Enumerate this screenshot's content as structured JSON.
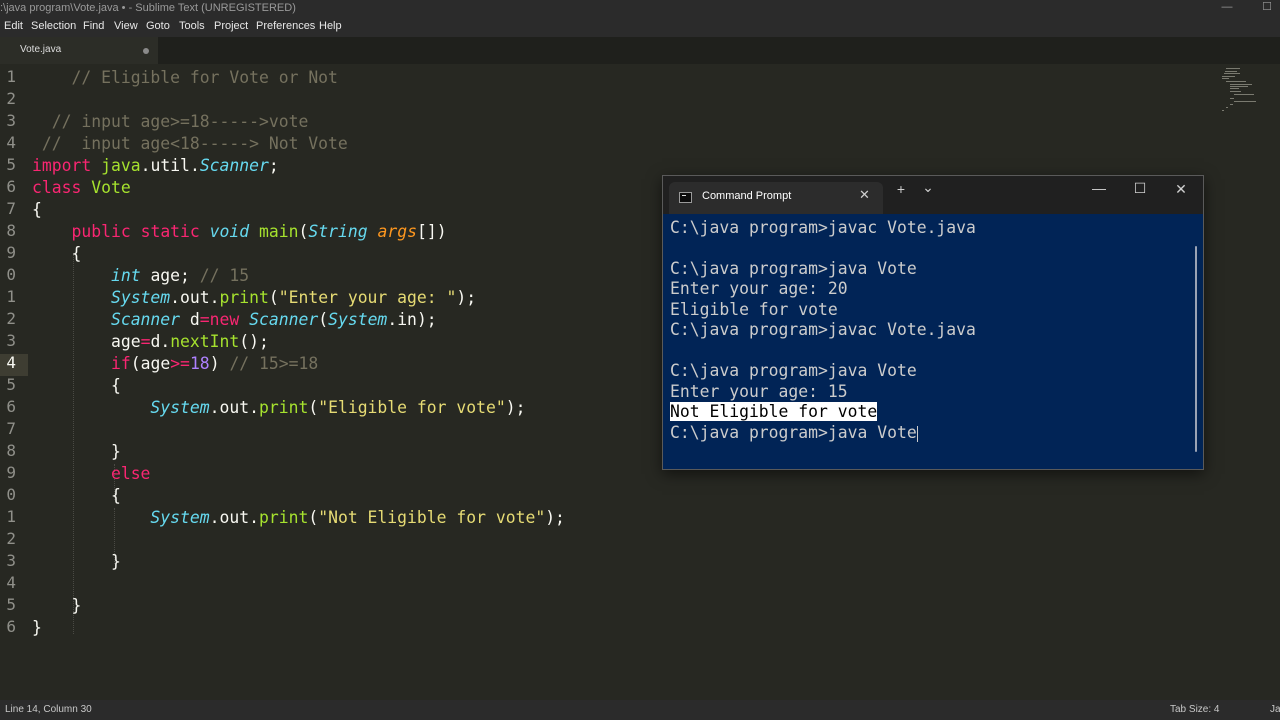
{
  "window": {
    "title": ":\\java program\\Vote.java • - Sublime Text (UNREGISTERED)",
    "minimize_glyph": "—",
    "maximize_glyph": "☐"
  },
  "menu": [
    "Edit",
    "Selection",
    "Find",
    "View",
    "Goto",
    "Tools",
    "Project",
    "Preferences",
    "Help"
  ],
  "tab": {
    "label": "Vote.java"
  },
  "gutter": [
    "1",
    "2",
    "3",
    "4",
    "5",
    "6",
    "7",
    "8",
    "9",
    "0",
    "1",
    "2",
    "3",
    "4",
    "5",
    "6",
    "7",
    "8",
    "9",
    "0",
    "1",
    "2",
    "3",
    "4",
    "5",
    "6"
  ],
  "code": [
    "    // Eligible for Vote or Not",
    "",
    "  // input age>=18----->vote",
    " //  input age<18-----> Not Vote",
    "import java.util.Scanner;",
    "class Vote",
    "{",
    "    public static void main(String args[])",
    "    {",
    "        int age; // 15",
    "        System.out.print(\"Enter your age: \");",
    "        Scanner d=new Scanner(System.in);",
    "        age=d.nextInt();",
    "        if(age>=18) // 15>=18",
    "        {",
    "            System.out.print(\"Eligible for vote\");",
    "",
    "        }",
    "        else",
    "        {",
    "            System.out.print(\"Not Eligible for vote\");",
    "",
    "        }",
    "",
    "    }",
    "}"
  ],
  "status": {
    "position": "Line 14, Column 30",
    "tab_size": "Tab Size: 4",
    "syntax": "Ja"
  },
  "cmd": {
    "tab_title": "Command Prompt",
    "close_glyph": "✕",
    "new_tab_glyph": "+",
    "dropdown_glyph": "⌄",
    "min_glyph": "—",
    "max_glyph": "☐",
    "win_close_glyph": "✕",
    "lines": [
      "C:\\java program>javac Vote.java",
      "",
      "C:\\java program>java Vote",
      "Enter your age: 20",
      "Eligible for vote",
      "C:\\java program>javac Vote.java",
      "",
      "C:\\java program>java Vote",
      "Enter your age: 15",
      "Not Eligible for vote",
      "C:\\java program>java Vote"
    ]
  },
  "colors": {
    "editor_bg": "#272822",
    "cmd_bg": "#012456",
    "keyword": "#f92672",
    "type": "#66d9ef",
    "function": "#a6e22e",
    "string": "#e6db74",
    "number": "#ae81ff",
    "comment": "#75715e"
  }
}
